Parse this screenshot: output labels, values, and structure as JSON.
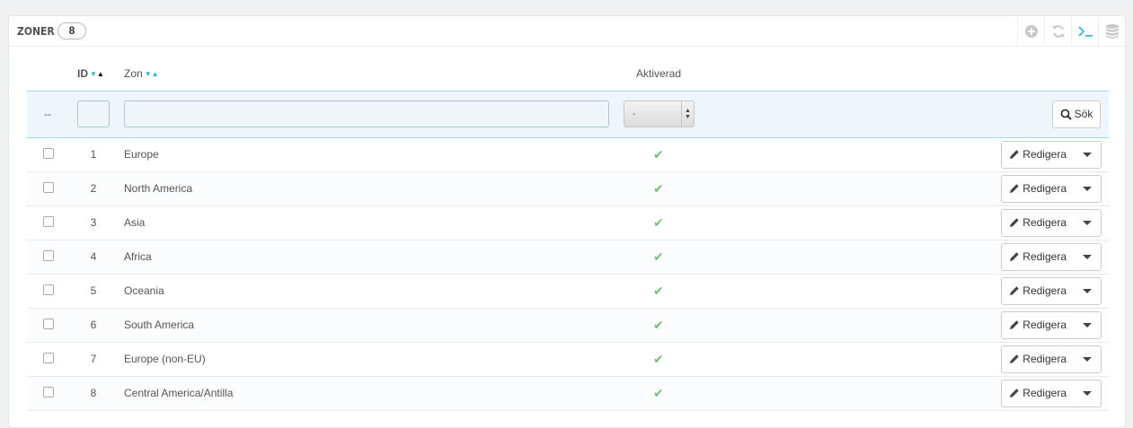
{
  "panel": {
    "title": "ZONER",
    "count": "8"
  },
  "toolbar": {
    "icons": [
      "add-icon",
      "refresh-icon",
      "sql-icon",
      "database-icon"
    ]
  },
  "columns": {
    "id": "ID",
    "zone": "Zon",
    "active": "Aktiverad"
  },
  "filters": {
    "checkbox_placeholder": "--",
    "active_select": "-",
    "search_label": "Sök"
  },
  "rows": [
    {
      "id": "1",
      "name": "Europe",
      "active": true
    },
    {
      "id": "2",
      "name": "North America",
      "active": true
    },
    {
      "id": "3",
      "name": "Asia",
      "active": true
    },
    {
      "id": "4",
      "name": "Africa",
      "active": true
    },
    {
      "id": "5",
      "name": "Oceania",
      "active": true
    },
    {
      "id": "6",
      "name": "South America",
      "active": true
    },
    {
      "id": "7",
      "name": "Europe (non-EU)",
      "active": true
    },
    {
      "id": "8",
      "name": "Central America/Antilla",
      "active": true
    }
  ],
  "row_action": {
    "edit_label": "Redigera"
  },
  "colors": {
    "accent": "#25b9d7",
    "active_check": "#72c279",
    "filter_bg": "#eef6fb"
  }
}
